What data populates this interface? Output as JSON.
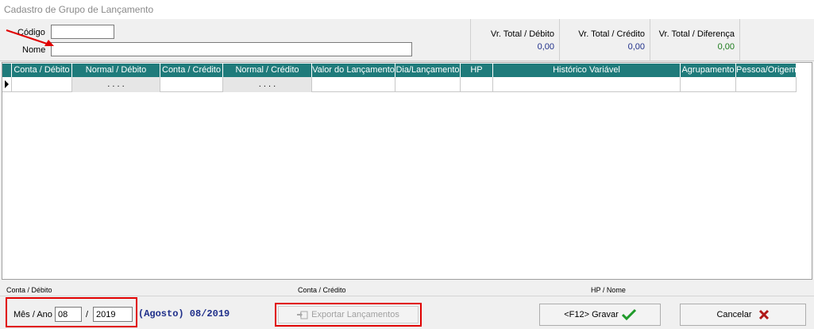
{
  "window": {
    "title": "Cadastro de Grupo de Lançamento"
  },
  "header": {
    "codigo_label": "Código",
    "codigo_value": "",
    "nome_label": "Nome",
    "nome_value": "",
    "totals": [
      {
        "label": "Vr. Total / Débito",
        "value": "0,00",
        "color": "#1f2f8a"
      },
      {
        "label": "Vr. Total / Crédito",
        "value": "0,00",
        "color": "#1f2f8a"
      },
      {
        "label": "Vr. Total / Diferença",
        "value": "0,00",
        "color": "#1a7a1a"
      }
    ]
  },
  "grid": {
    "columns": [
      "Conta / Débito",
      "Normal / Débito",
      "Conta / Crédito",
      "Normal / Crédito",
      "Valor do Lançamento",
      "Dia/Lançamento",
      "HP",
      "Histórico Variável",
      "Agrupamento",
      "Pessoa/Origem"
    ],
    "header_color": "#1f7b7b",
    "row": [
      "",
      ". . . .",
      "",
      ". . . .",
      "",
      "",
      "",
      "",
      "",
      ""
    ]
  },
  "info": {
    "conta_debito": "Conta / Débito",
    "conta_credito": "Conta / Crédito",
    "hp_nome": "HP / Nome"
  },
  "footer": {
    "mes_ano_label": "Mês / Ano",
    "mes_value": "08",
    "separator": "/",
    "ano_value": "2019",
    "month_text": "(Agosto) 08/2019",
    "export_label": "Exportar Lançamentos",
    "save_label": "<F12> Gravar",
    "cancel_label": "Cancelar"
  }
}
